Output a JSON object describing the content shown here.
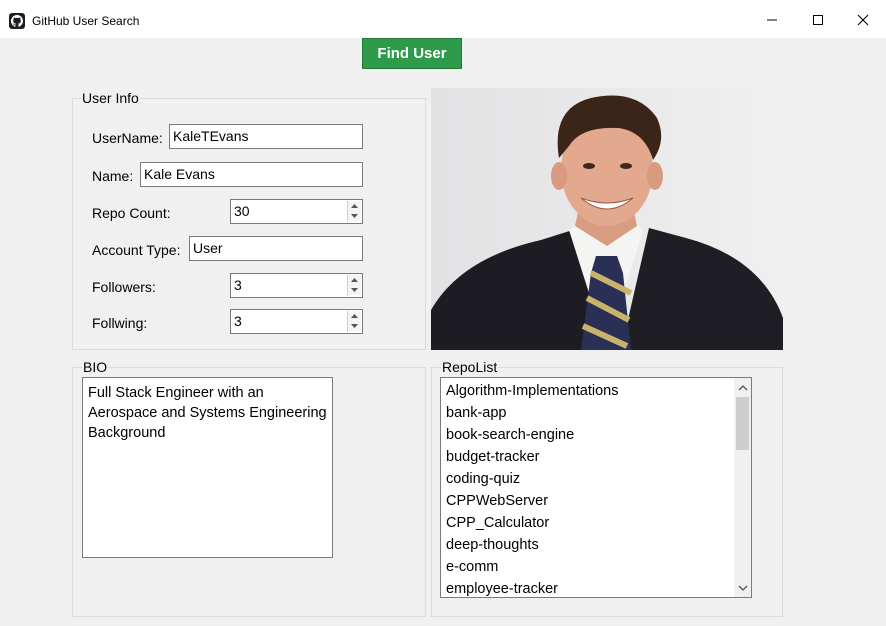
{
  "window": {
    "title": "GitHub User Search",
    "minimize_icon": "minimize-icon",
    "maximize_icon": "maximize-icon",
    "close_icon": "close-icon",
    "app_icon": "github-icon"
  },
  "toolbar": {
    "find_label": "Find User",
    "find_color": "#2e9b4a"
  },
  "user_info": {
    "group_title": "User Info",
    "username_label": "UserName:",
    "username_value": "KaleTEvans",
    "name_label": "Name:",
    "name_value": "Kale Evans",
    "repo_count_label": "Repo Count:",
    "repo_count_value": "30",
    "account_type_label": "Account Type:",
    "account_type_value": "User",
    "followers_label": "Followers:",
    "followers_value": "3",
    "following_label": "Follwing:",
    "following_value": "3"
  },
  "bio": {
    "group_title": "BIO",
    "lines": [
      "Full Stack Engineer with an",
      "Aerospace and Systems Engineering",
      "Background"
    ]
  },
  "repo_list": {
    "group_title": "RepoList",
    "items": [
      "Algorithm-Implementations",
      "bank-app",
      "book-search-engine",
      "budget-tracker",
      "coding-quiz",
      "CPPWebServer",
      "CPP_Calculator",
      "deep-thoughts",
      "e-comm",
      "employee-tracker"
    ]
  }
}
